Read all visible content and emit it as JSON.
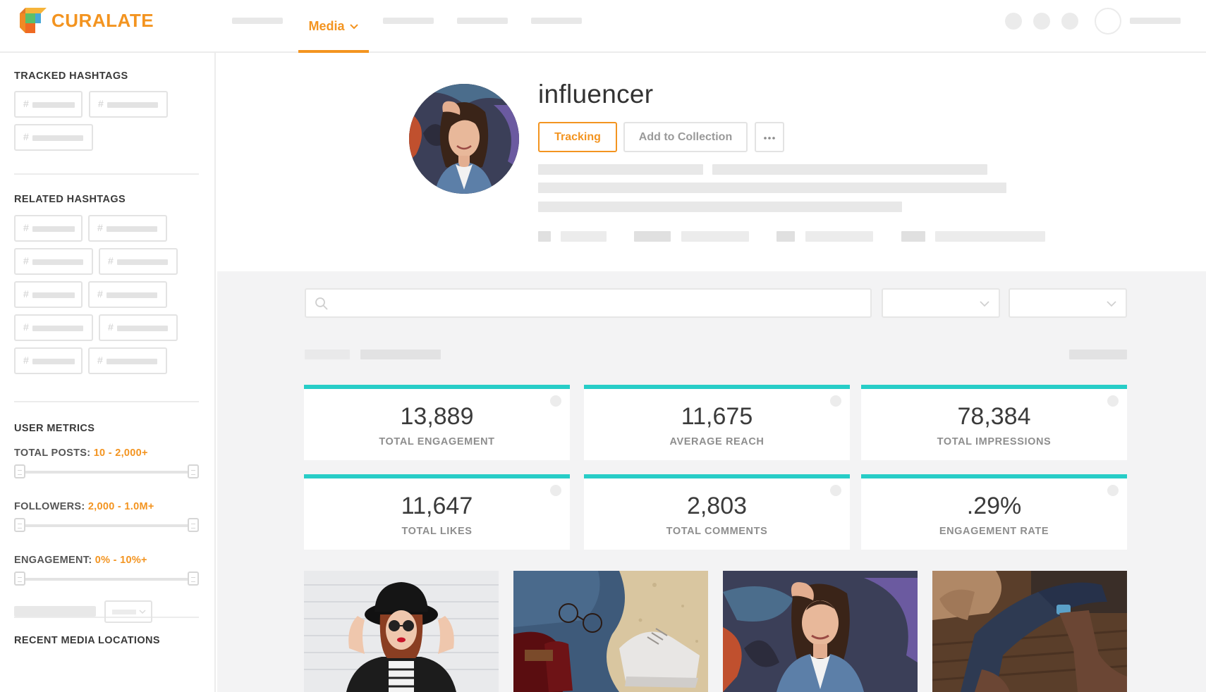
{
  "brand": {
    "name": "CURALATE",
    "color": "#f39420"
  },
  "nav": {
    "active_label": "Media",
    "accent": "#f39420"
  },
  "sidebar": {
    "tracked_title": "TRACKED HASHTAGS",
    "related_title": "RELATED HASHTAGS",
    "metrics_title": "USER METRICS",
    "metrics": [
      {
        "label": "TOTAL POSTS:",
        "value": "10 - 2,000+"
      },
      {
        "label": "FOLLOWERS:",
        "value": "2,000 - 1.0M+"
      },
      {
        "label": "ENGAGEMENT:",
        "value": "0% - 10%+"
      }
    ],
    "locations_title": "RECENT MEDIA LOCATIONS",
    "hash_symbol": "#"
  },
  "profile": {
    "username": "influencer",
    "tracking_label": "Tracking",
    "collection_label": "Add to Collection"
  },
  "search": {
    "placeholder": ""
  },
  "stats_accent": "#27cdc7",
  "stats": [
    {
      "value": "13,889",
      "label": "TOTAL ENGAGEMENT"
    },
    {
      "value": "11,675",
      "label": "AVERAGE REACH"
    },
    {
      "value": "78,384",
      "label": "TOTAL IMPRESSIONS"
    },
    {
      "value": "11,647",
      "label": "TOTAL LIKES"
    },
    {
      "value": "2,803",
      "label": "TOTAL COMMENTS"
    },
    {
      "value": ".29%",
      "label": "ENGAGEMENT RATE"
    }
  ]
}
